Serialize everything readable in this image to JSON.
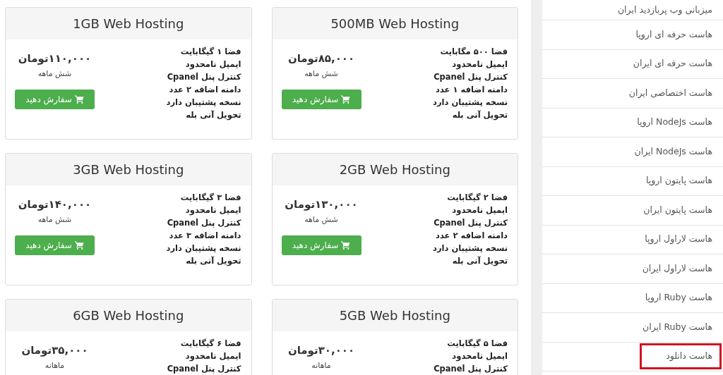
{
  "plans": [
    {
      "title": "500MB Web Hosting",
      "features": [
        "فضا ۵۰۰ مگابایت",
        "ایمیل نامحدود",
        "کنترل پنل Cpanel",
        "دامنه اضافه ۱ عدد",
        "نسخه پشتیبان دارد",
        "تحویل آنی بله"
      ],
      "price": "۸۵,۰۰۰تومان",
      "period": "شش ماهه",
      "button": "سفارش دهید"
    },
    {
      "title": "1GB Web Hosting",
      "features": [
        "فضا ۱ گیگابایت",
        "ایمیل نامحدود",
        "کنترل پنل Cpanel",
        "دامنه اضافه ۲ عدد",
        "نسخه پشتیبان دارد",
        "تحویل آنی بله"
      ],
      "price": "۱۱۰,۰۰۰تومان",
      "period": "شش ماهه",
      "button": "سفارش دهید"
    },
    {
      "title": "2GB Web Hosting",
      "features": [
        "فضا ۲ گیگابایت",
        "ایمیل نامحدود",
        "کنترل پنل Cpanel",
        "دامنه اضافه ۲ عدد",
        "نسخه پشتیبان دارد",
        "تحویل آنی بله"
      ],
      "price": "۱۳۰,۰۰۰تومان",
      "period": "شش ماهه",
      "button": "سفارش دهید"
    },
    {
      "title": "3GB Web Hosting",
      "features": [
        "فضا ۳ گیگابایت",
        "ایمیل نامحدود",
        "کنترل پنل Cpanel",
        "دامنه اضافه ۳ عدد",
        "نسخه پشتیبان دارد",
        "تحویل آنی بله"
      ],
      "price": "۱۴۰,۰۰۰تومان",
      "period": "شش ماهه",
      "button": "سفارش دهید"
    },
    {
      "title": "5GB Web Hosting",
      "features": [
        "فضا ۵ گیگابایت",
        "ایمیل نامحدود",
        "کنترل پنل Cpanel"
      ],
      "price": "۳۰,۰۰۰تومان",
      "period": "ماهانه"
    },
    {
      "title": "6GB Web Hosting",
      "features": [
        "فضا ۶ گیگابایت",
        "ایمیل نامحدود",
        "کنترل پنل Cpanel"
      ],
      "price": "۳۵,۰۰۰تومان",
      "period": "ماهانه"
    }
  ],
  "sidebar": {
    "items": [
      {
        "label": "میزبانی وب پربازدید ایران",
        "highlighted": false
      },
      {
        "label": "هاست حرفه ای اروپا",
        "highlighted": false
      },
      {
        "label": "هاست حرفه ای ایران",
        "highlighted": false
      },
      {
        "label": "هاست اختصاصی ایران",
        "highlighted": false
      },
      {
        "label": "هاست NodeJs اروپا",
        "highlighted": false
      },
      {
        "label": "هاست NodeJs ایران",
        "highlighted": false
      },
      {
        "label": "هاست پایتون اروپا",
        "highlighted": false
      },
      {
        "label": "هاست پایتون ایران",
        "highlighted": false
      },
      {
        "label": "هاست لاراول اروپا",
        "highlighted": false
      },
      {
        "label": "هاست لاراول ایران",
        "highlighted": false
      },
      {
        "label": "هاست Ruby اروپا",
        "highlighted": false
      },
      {
        "label": "هاست Ruby ایران",
        "highlighted": false
      },
      {
        "label": "هاست دانلود",
        "highlighted": true
      }
    ]
  }
}
